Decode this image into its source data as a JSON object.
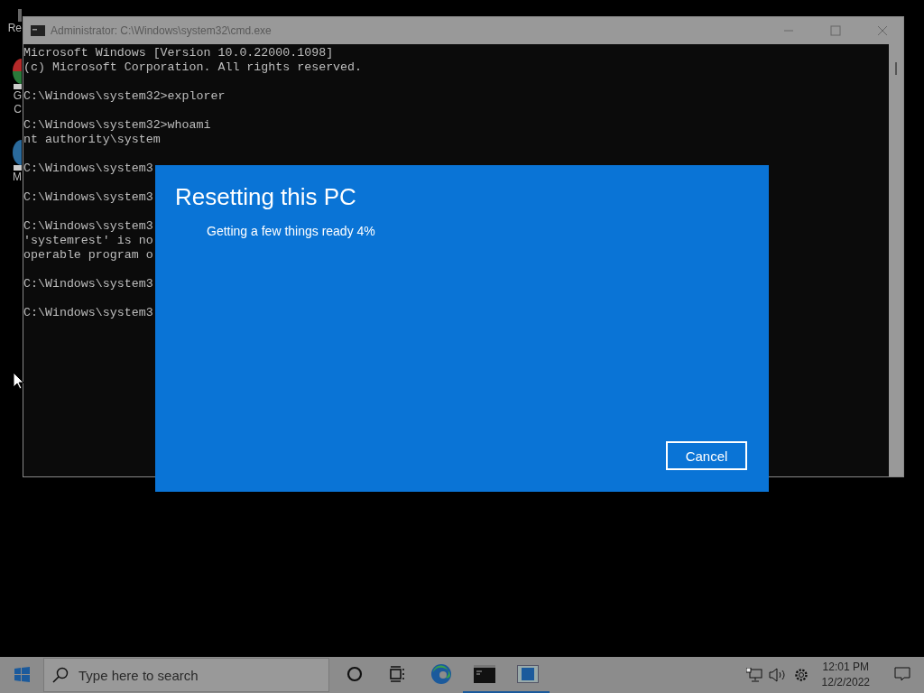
{
  "desktop_icons": [
    {
      "label": "Re",
      "kind": "bin"
    },
    {
      "label": "G\nC",
      "kind": "chrome"
    },
    {
      "label": "M",
      "kind": "edge"
    }
  ],
  "console_window": {
    "title": "Administrator: C:\\Windows\\system32\\cmd.exe",
    "blocks": [
      [
        "Microsoft Windows [Version 10.0.22000.1098]",
        "(c) Microsoft Corporation. All rights reserved."
      ],
      [
        "C:\\Windows\\system32>explorer"
      ],
      [
        "C:\\Windows\\system32>whoami",
        "nt authority\\system"
      ],
      [
        "C:\\Windows\\system3"
      ],
      [
        "C:\\Windows\\system3"
      ],
      [
        "C:\\Windows\\system3",
        "'systemrest' is no",
        "operable program o"
      ],
      [
        "C:\\Windows\\system3"
      ],
      [
        "C:\\Windows\\system3"
      ]
    ]
  },
  "dialog": {
    "title": "Resetting this PC",
    "message": "Getting a few things ready 4%",
    "button": "Cancel"
  },
  "taskbar": {
    "search": {
      "placeholder": "Type here to search"
    },
    "apps": [
      {
        "kind": "cortana",
        "running": false
      },
      {
        "kind": "taskview",
        "running": false
      },
      {
        "kind": "edge",
        "running": false
      },
      {
        "kind": "cmd",
        "running": true
      },
      {
        "kind": "window",
        "running": true
      }
    ],
    "time": "12:01 PM",
    "date": "12/2/2022"
  }
}
